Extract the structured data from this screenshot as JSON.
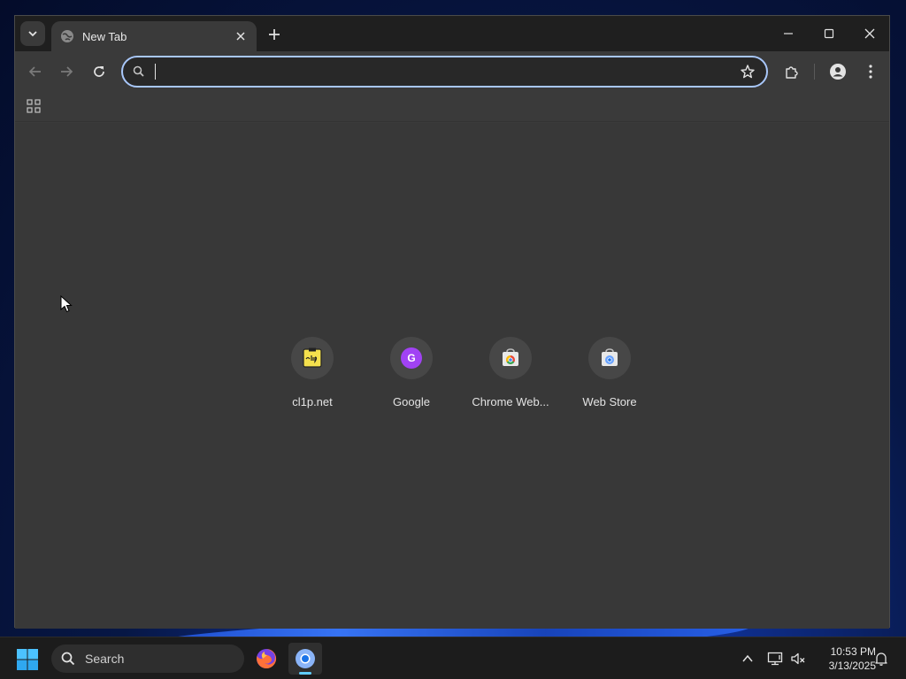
{
  "browser": {
    "tab": {
      "title": "New Tab"
    },
    "omnibox": {
      "value": "",
      "placeholder": ""
    },
    "shortcuts": [
      {
        "label": "cl1p.net",
        "icon": "cl1p-favicon"
      },
      {
        "label": "Google",
        "icon": "google-letter-icon",
        "letter": "G"
      },
      {
        "label": "Chrome Web...",
        "icon": "chrome-web-store-icon"
      },
      {
        "label": "Web Store",
        "icon": "web-store-icon"
      }
    ]
  },
  "taskbar": {
    "search_label": "Search",
    "clock": {
      "time": "10:53 PM",
      "date": "3/13/2025"
    }
  },
  "colors": {
    "omnibox_focus": "#a8c7fa",
    "google_purple": "#a142f4",
    "cl1p_yellow": "#f4e04d",
    "taskbar_indicator": "#60cdff"
  }
}
